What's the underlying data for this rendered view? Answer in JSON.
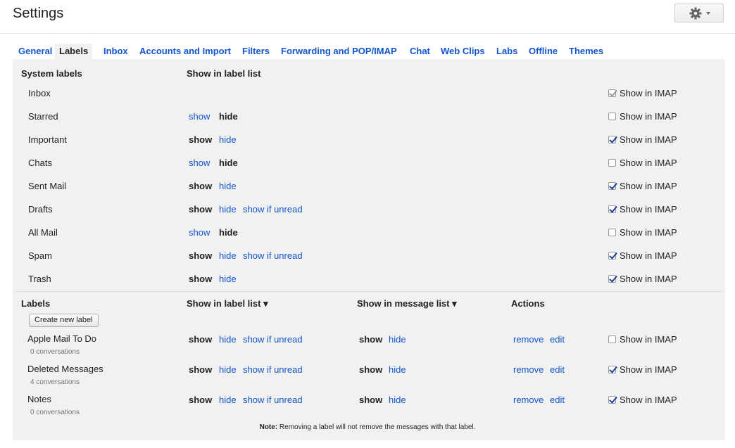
{
  "header": {
    "title": "Settings"
  },
  "tabs": [
    "General",
    "Labels",
    "Inbox",
    "Accounts and Import",
    "Filters",
    "Forwarding and POP/IMAP",
    "Chat",
    "Web Clips",
    "Labs",
    "Offline",
    "Themes"
  ],
  "active_tab": "Labels",
  "system": {
    "header_name": "System labels",
    "header_show": "Show in label list",
    "rows": [
      {
        "name": "Inbox",
        "opts": [],
        "imap_label": "Show in IMAP",
        "imap_checked": true,
        "imap_disabled": true
      },
      {
        "name": "Starred",
        "opts": [
          {
            "t": "show",
            "b": false
          },
          {
            "t": "hide",
            "b": true
          }
        ],
        "imap_label": "Show in IMAP",
        "imap_checked": false
      },
      {
        "name": "Important",
        "opts": [
          {
            "t": "show",
            "b": true
          },
          {
            "t": "hide",
            "b": false
          }
        ],
        "imap_label": "Show in IMAP",
        "imap_checked": true
      },
      {
        "name": "Chats",
        "opts": [
          {
            "t": "show",
            "b": false
          },
          {
            "t": "hide",
            "b": true
          }
        ],
        "imap_label": "Show in IMAP",
        "imap_checked": false
      },
      {
        "name": "Sent Mail",
        "opts": [
          {
            "t": "show",
            "b": true
          },
          {
            "t": "hide",
            "b": false
          }
        ],
        "imap_label": "Show in IMAP",
        "imap_checked": true
      },
      {
        "name": "Drafts",
        "opts": [
          {
            "t": "show",
            "b": true
          },
          {
            "t": "hide",
            "b": false
          },
          {
            "t": "show if unread",
            "b": false
          }
        ],
        "imap_label": "Show in IMAP",
        "imap_checked": true
      },
      {
        "name": "All Mail",
        "opts": [
          {
            "t": "show",
            "b": false
          },
          {
            "t": "hide",
            "b": true
          }
        ],
        "imap_label": "Show in IMAP",
        "imap_checked": false
      },
      {
        "name": "Spam",
        "opts": [
          {
            "t": "show",
            "b": true
          },
          {
            "t": "hide",
            "b": false
          },
          {
            "t": "show if unread",
            "b": false
          }
        ],
        "imap_label": "Show in IMAP",
        "imap_checked": true
      },
      {
        "name": "Trash",
        "opts": [
          {
            "t": "show",
            "b": true
          },
          {
            "t": "hide",
            "b": false
          }
        ],
        "imap_label": "Show in IMAP",
        "imap_checked": true
      }
    ]
  },
  "labels": {
    "header_name": "Labels",
    "header_show": "Show in label list ▾",
    "header_msg": "Show in message list ▾",
    "header_actions": "Actions",
    "create_button": "Create new label",
    "rows": [
      {
        "name": "Apple Mail To Do",
        "count": "0 conversations",
        "opts": [
          {
            "t": "show",
            "b": true
          },
          {
            "t": "hide",
            "b": false
          },
          {
            "t": "show if unread",
            "b": false
          }
        ],
        "msg": [
          {
            "t": "show",
            "b": true
          },
          {
            "t": "hide",
            "b": false
          }
        ],
        "actions": [
          "remove",
          "edit"
        ],
        "imap_label": "Show in IMAP",
        "imap_checked": false
      },
      {
        "name": "Deleted Messages",
        "count": "4 conversations",
        "opts": [
          {
            "t": "show",
            "b": true
          },
          {
            "t": "hide",
            "b": false
          },
          {
            "t": "show if unread",
            "b": false
          }
        ],
        "msg": [
          {
            "t": "show",
            "b": true
          },
          {
            "t": "hide",
            "b": false
          }
        ],
        "actions": [
          "remove",
          "edit"
        ],
        "imap_label": "Show in IMAP",
        "imap_checked": true
      },
      {
        "name": "Notes",
        "count": "0 conversations",
        "opts": [
          {
            "t": "show",
            "b": true
          },
          {
            "t": "hide",
            "b": false
          },
          {
            "t": "show if unread",
            "b": false
          }
        ],
        "msg": [
          {
            "t": "show",
            "b": true
          },
          {
            "t": "hide",
            "b": false
          }
        ],
        "actions": [
          "remove",
          "edit"
        ],
        "imap_label": "Show in IMAP",
        "imap_checked": true
      }
    ]
  },
  "note": {
    "prefix": "Note:",
    "text": " Removing a label will not remove the messages with that label."
  }
}
